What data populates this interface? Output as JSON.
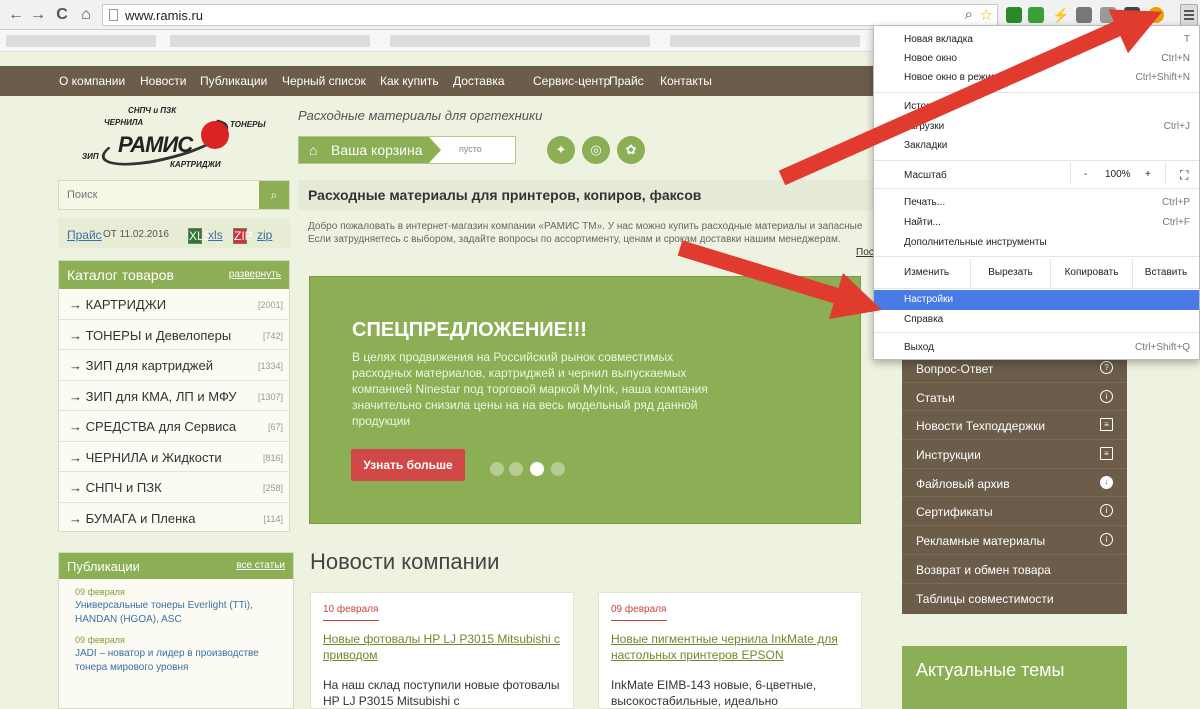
{
  "browser": {
    "url": "www.ramis.ru",
    "back_icon": "←",
    "forward_icon": "→",
    "reload_icon": "C",
    "home_icon": "⌂"
  },
  "site": {
    "nav": [
      "О компании",
      "Новости",
      "Публикации",
      "Черный список",
      "Как купить",
      "Доставка",
      "Сервис-центр",
      "Прайс",
      "Контакты"
    ],
    "logo": {
      "brand": "РАМИС",
      "tags": [
        "СНПЧ и ПЗК",
        "ЧЕРНИЛА",
        "ТОНЕРЫ",
        "ЗИП",
        "КАРТРИДЖИ"
      ]
    },
    "slogan": "Расходные материалы для оргтехники",
    "cart": {
      "label": "Ваша корзина",
      "status": "пусто"
    },
    "search_placeholder": "Поиск",
    "price": {
      "link": "Прайс",
      "date": "ОТ 11.02.2016",
      "xls": "xls",
      "zip": "zip"
    },
    "catalog": {
      "title": "Каталог товаров",
      "expand": "развернуть",
      "items": [
        {
          "label": "КАРТРИДЖИ",
          "count": "[2001]"
        },
        {
          "label": "ТОНЕРЫ и Девелоперы",
          "count": "[742]"
        },
        {
          "label": "ЗИП для картриджей",
          "count": "[1334]"
        },
        {
          "label": "ЗИП для КМА, ЛП и МФУ",
          "count": "[1307]"
        },
        {
          "label": "СРЕДСТВА для Сервиса",
          "count": "[67]"
        },
        {
          "label": "ЧЕРНИЛА и Жидкости",
          "count": "[816]"
        },
        {
          "label": "СНПЧ и ПЗК",
          "count": "[258]"
        },
        {
          "label": "БУМАГА и Пленка",
          "count": "[114]"
        }
      ]
    },
    "publications": {
      "title": "Публикации",
      "all": "все статьи",
      "items": [
        {
          "date": "09 февраля",
          "title": "Универсальные тонеры Everlight (TTi), HANDAN (HGOA), ASC"
        },
        {
          "date": "09 февраля",
          "title": "JADI – новатор и лидер в производстве тонера мирового уровня"
        }
      ]
    },
    "main_heading": "Расходные материалы для принтеров, копиров, факсов",
    "welcome": "Добро пожаловать в интернет-магазин компании «РАМИС ТМ». У нас можно купить расходные материалы и запасные Если затрудняетесь с выбором, задайте вопросы по ассортименту, ценам и срокам доставки нашим менеджерам.",
    "welcome_more": "Пос",
    "promo": {
      "title": "СПЕЦПРЕДЛОЖЕНИЕ!!!",
      "text": "В целях продвижения на Российский рынок совместимых расходных материалов, картриджей и чернил выпускаемых компанией Ninestar под торговой маркой MyInk, наша компания  значительно снизила цены  на на весь модельный ряд данной продукции",
      "button": "Узнать больше",
      "active_slide": 3
    },
    "news": {
      "title": "Новости компании",
      "items": [
        {
          "date": "10 февраля",
          "title": "Новые фотовалы HP LJ P3015 Mitsubishi с приводом",
          "text": "На наш склад поступили новые фотовалы HP LJ P3015 Mitsubishi с"
        },
        {
          "date": "09 февраля",
          "title": "Новые пигментные чернила InkMate для настольных принтеров EPSON",
          "text": "InkMate EIMB-143 новые, 6-цветные, высокостабильные,  идеально"
        }
      ]
    },
    "sidebar": [
      "Вопрос-Ответ",
      "Статьи",
      "Новости Техподдержки",
      "Инструкции",
      "Файловый архив",
      "Сертификаты",
      "Рекламные материалы",
      "Возврат и обмен товара",
      "Таблицы совместимости"
    ],
    "topics": "Актуальные темы"
  },
  "menu": {
    "new_tab": "Новая вкладка",
    "new_tab_sc": "T",
    "new_window": "Новое окно",
    "new_window_sc": "Ctrl+N",
    "incognito": "Новое окно в режиме и",
    "incognito_sc": "Ctrl+Shift+N",
    "history": "История",
    "downloads": "Загрузки",
    "downloads_sc": "Ctrl+J",
    "bookmarks": "Закладки",
    "zoom_label": "Масштаб",
    "zoom_minus": "-",
    "zoom_value": "100%",
    "zoom_plus": "+",
    "print": "Печать...",
    "print_sc": "Ctrl+P",
    "find": "Найти...",
    "find_sc": "Ctrl+F",
    "more_tools": "Дополнительные инструменты",
    "edit": "Изменить",
    "cut": "Вырезать",
    "copy": "Копировать",
    "paste": "Вставить",
    "settings": "Настройки",
    "help": "Справка",
    "exit": "Выход",
    "exit_sc": "Ctrl+Shift+Q"
  },
  "colors": {
    "accent_green": "#8cae54",
    "nav_brown": "#6b5d4a",
    "highlight": "#4a7ae6",
    "arrow": "#e03b2e"
  }
}
